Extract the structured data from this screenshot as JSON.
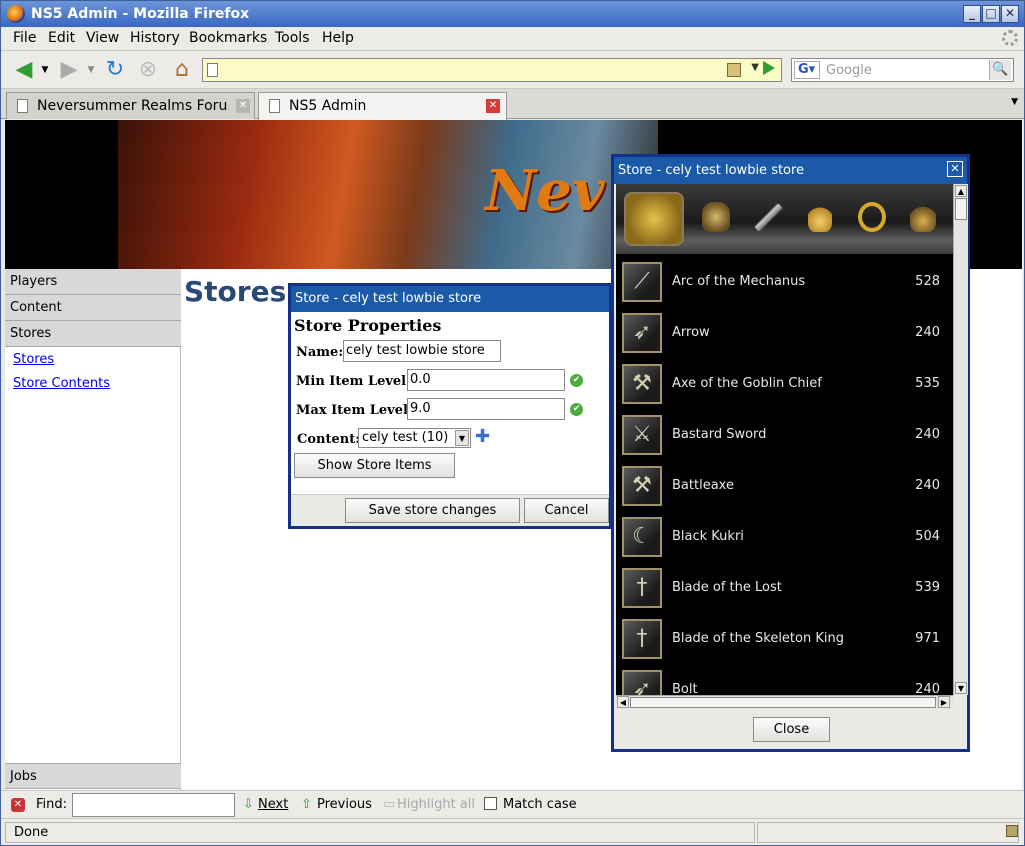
{
  "window": {
    "title": "NS5 Admin - Mozilla Firefox"
  },
  "menu": [
    "File",
    "Edit",
    "View",
    "History",
    "Bookmarks",
    "Tools",
    "Help"
  ],
  "search": {
    "placeholder": "Google"
  },
  "tabs": [
    {
      "label": "Neversummer Realms Foru...",
      "active": false
    },
    {
      "label": "NS5 Admin",
      "active": true
    }
  ],
  "banner": {
    "logo_text": "Nev"
  },
  "sidebar": {
    "sections": [
      "Players",
      "Content",
      "Stores"
    ],
    "links": [
      "Stores",
      "Store Contents"
    ],
    "bottom": "Jobs"
  },
  "page_title": "Stores",
  "props_dialog": {
    "title": "Store - cely test lowbie store",
    "heading": "Store Properties",
    "name_label": "Name:",
    "name_value": "cely test lowbie store",
    "min_label": "Min Item Level:",
    "min_value": "0.0",
    "max_label": "Max Item Level:",
    "max_value": "9.0",
    "content_label": "Content:",
    "content_value": "cely test (10)",
    "show_items": "Show Store Items",
    "save": "Save store changes",
    "cancel": "Cancel"
  },
  "items_dialog": {
    "title": "Store - cely test lowbie store",
    "close": "Close",
    "categories": [
      "gold-coins",
      "armor",
      "weapon",
      "potion",
      "ring",
      "bag"
    ],
    "items": [
      {
        "name": "Arc of the Mechanus",
        "price": "528"
      },
      {
        "name": "Arrow",
        "price": "240"
      },
      {
        "name": "Axe of the Goblin Chief",
        "price": "535"
      },
      {
        "name": "Bastard Sword",
        "price": "240"
      },
      {
        "name": "Battleaxe",
        "price": "240"
      },
      {
        "name": "Black Kukri",
        "price": "504"
      },
      {
        "name": "Blade of the Lost",
        "price": "539"
      },
      {
        "name": "Blade of the Skeleton King",
        "price": "971"
      },
      {
        "name": "Bolt",
        "price": "240"
      }
    ]
  },
  "findbar": {
    "label": "Find:",
    "next": "Next",
    "previous": "Previous",
    "highlight": "Highlight all",
    "match": "Match case"
  },
  "status": {
    "text": "Done"
  },
  "colors": {
    "accent": "#1a5aa8",
    "dialog_border": "#13308a",
    "check": "#4cab3a"
  }
}
